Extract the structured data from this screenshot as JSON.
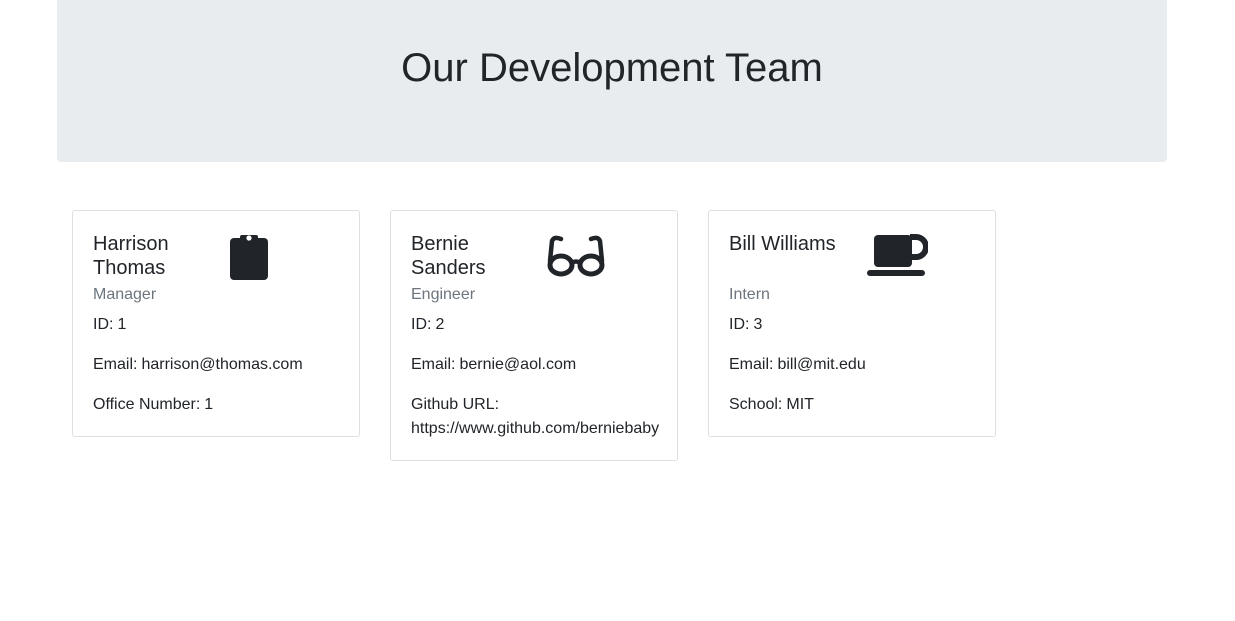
{
  "header": {
    "title": "Our Development Team"
  },
  "team": [
    {
      "name": "Harrison Thomas",
      "role": "Manager",
      "icon": "clipboard-icon",
      "id_label": "ID:",
      "id": "1",
      "email_label": "Email:",
      "email": "harrison@thomas.com",
      "extra_label": "Office Number:",
      "extra_value": "1"
    },
    {
      "name": "Bernie Sanders",
      "role": "Engineer",
      "icon": "glasses-icon",
      "id_label": "ID:",
      "id": "2",
      "email_label": "Email:",
      "email": "bernie@aol.com",
      "extra_label": "Github URL:",
      "extra_value": "https://www.github.com/berniebaby"
    },
    {
      "name": "Bill Williams",
      "role": "Intern",
      "icon": "coffee-mug-icon",
      "id_label": "ID:",
      "id": "3",
      "email_label": "Email:",
      "email": "bill@mit.edu",
      "extra_label": "School:",
      "extra_value": "MIT"
    }
  ],
  "colors": {
    "header_bg": "#e9ecef",
    "text": "#212529",
    "muted": "#6c757d",
    "card_border": "#dfdfdf"
  }
}
